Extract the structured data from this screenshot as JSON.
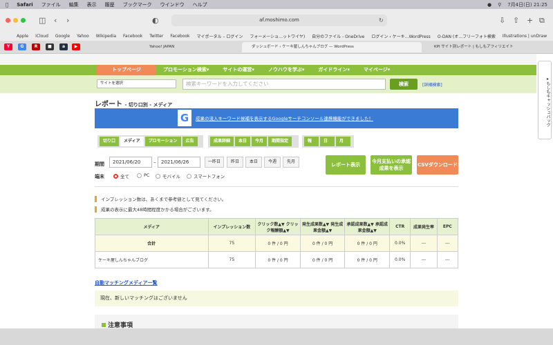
{
  "menubar": {
    "app": "Safari",
    "items": [
      "ファイル",
      "編集",
      "表示",
      "履歴",
      "ブックマーク",
      "ウインドウ",
      "ヘルプ"
    ],
    "datetime": "7月4日(日) 21:25"
  },
  "browser": {
    "url": "af.moshimo.com"
  },
  "bookmarks": [
    "Apple",
    "iCloud",
    "Google",
    "Yahoo",
    "Wikipedia",
    "Facebook",
    "Twitter",
    "Facebook",
    "マイポータル – ログイン",
    "フォーメーショ…ットワイヤ)",
    "自分のファイル - OneDrive",
    "ログイン ‹ ケーキ…WordPress",
    "O-DAN (オ…フリーフォト検索",
    "Illustrations | unDraw"
  ],
  "tabs": {
    "yahoo": "Yahoo! JAPAN",
    "active": "ダッシュボード ‹ ケーキ屋しんちゃんブログ — WordPress",
    "kpi": "KPI サイト別レポート | もしもアフィリエイト"
  },
  "site": {
    "nav": [
      "トップページ",
      "プロモーション検索▾",
      "サイトの運営▾",
      "ノウハウを学ぶ▾",
      "ガイドライン▾",
      "マイページ▾"
    ],
    "site_select": "サイトを選択",
    "keyword_placeholder": "検索キーワードを入力してください",
    "search_button": "検索",
    "advanced": "[詳細検索]",
    "title": "レポート",
    "subtitle": "- 切り口別 - メディア",
    "banner": "成果の流入キーワード候補を表示するGoogleサーチコンソール連携機能ができました！",
    "tabs_a": [
      "切り口",
      "メディア",
      "プロモーション",
      "広告"
    ],
    "tabs_b": [
      "成果詳細",
      "本日",
      "今月",
      "期間指定"
    ],
    "tabs_c": [
      "報酬",
      "日次",
      "月次"
    ],
    "period_label": "期間",
    "date_from": "2021/06/20",
    "date_to": "2021/06/26",
    "dash": "–",
    "period_buttons": [
      "一昨日",
      "昨日",
      "本日",
      "今週",
      "先月"
    ],
    "report_button": "レポート表示",
    "month_pay_button": "今月支払いの承認成果を表示",
    "csv_button": "CSVダウンロード",
    "device_label": "端末",
    "devices": [
      "全て",
      "PC",
      "モバイル",
      "スマートフォン"
    ],
    "note1": "インプレッション数は、あくまで参考値として見てください。",
    "note2": "成果の表示に最大48時間程度かかる場合がございます。",
    "table": {
      "headers": [
        "メディア",
        "インプレッション数",
        "クリック数▲▼ クリック報酬額▲▼",
        "発生成果数▲▼ 発生成果金額▲▼",
        "承認成果数▲▼ 承認成果金額▲▼",
        "CTR",
        "成果発生率",
        "EPC"
      ],
      "total": [
        "合計",
        "75",
        "0 件 / 0 円",
        "0 件 / 0 円",
        "0 件 / 0 円",
        "0.0%",
        "---",
        "---"
      ],
      "rows": [
        [
          "ケーキ屋しんちゃんブログ",
          "75",
          "0 件 / 0 円",
          "0 件 / 0 円",
          "0 件 / 0 円",
          "0.0%",
          "---",
          "---"
        ]
      ]
    },
    "matching_link": "自動マッチングメディア一覧",
    "matching_text": "現在、新しいマッチングはございません",
    "attention": "注意事項",
    "side_label": "▸もしもキャッシュバック"
  },
  "colors": {
    "green": "#8cbf3e",
    "orange": "#f08a58",
    "blue": "#3a7bd5"
  }
}
